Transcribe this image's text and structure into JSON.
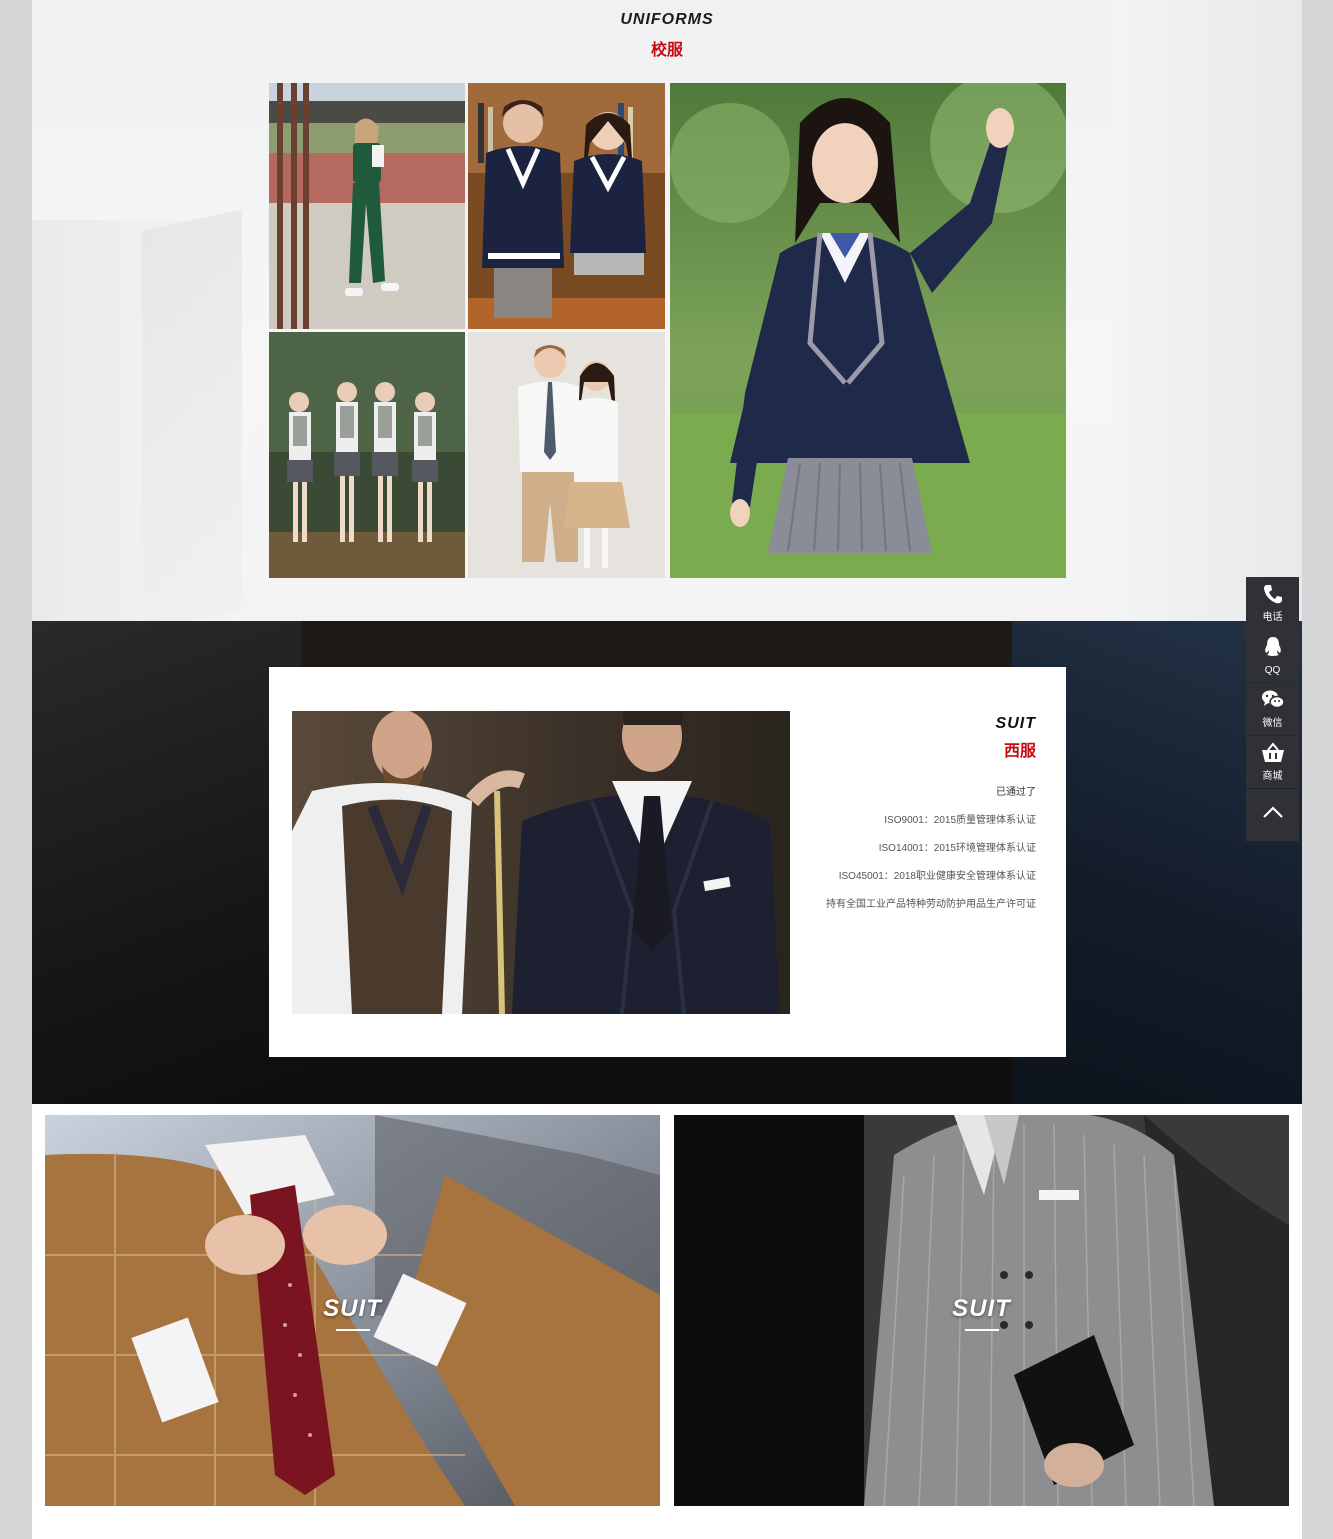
{
  "uniforms": {
    "title_en": "UNIFORMS",
    "title_cn": "校服"
  },
  "suit_section": {
    "title_en": "SUIT",
    "title_cn": "西服",
    "passed_label": "已通过了",
    "certifications": [
      "ISO9001：2015质量管理体系认证",
      "ISO14001：2015环境管理体系认证",
      "ISO45001：2018职业健康安全管理体系认证",
      "持有全国工业产品特种劳动防护用品生产许可证"
    ]
  },
  "tiles": [
    {
      "label": "SUIT"
    },
    {
      "label": "SUIT"
    }
  ],
  "sidebar": {
    "items": [
      {
        "label": "电话",
        "icon": "phone-icon"
      },
      {
        "label": "QQ",
        "icon": "qq-icon"
      },
      {
        "label": "微信",
        "icon": "wechat-icon"
      },
      {
        "label": "商城",
        "icon": "shop-cart-icon"
      }
    ],
    "back_to_top_icon": "chevron-up-icon"
  },
  "colors": {
    "accent_red": "#c40c12",
    "sidebar_bg": "#2f3135"
  }
}
